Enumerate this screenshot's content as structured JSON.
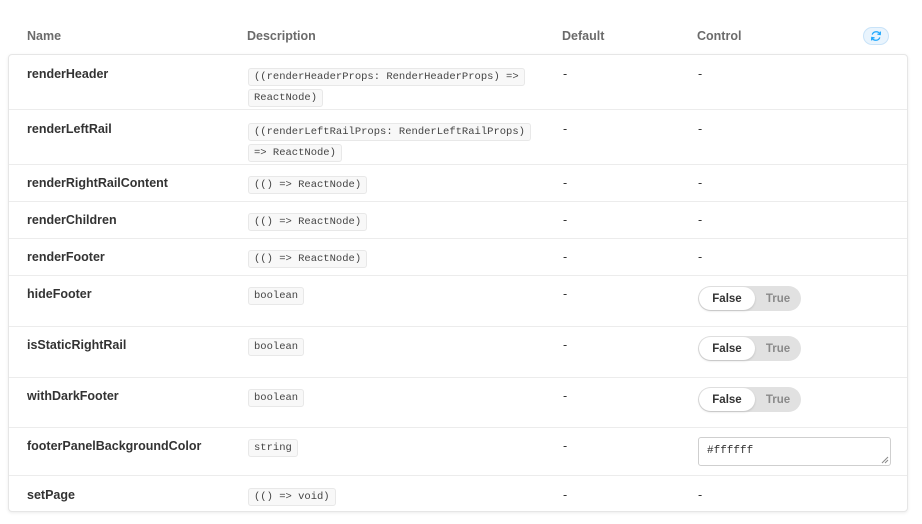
{
  "columns": {
    "name": "Name",
    "description": "Description",
    "default": "Default",
    "control": "Control"
  },
  "reset_icon": "refresh-icon",
  "colors": {
    "accent": "#1ea7fd",
    "border": "#e6e6e6",
    "toggle_bg": "#e1e1e1"
  },
  "rows": [
    {
      "name": "renderHeader",
      "type": "((renderHeaderProps: RenderHeaderProps) => ReactNode)",
      "default": "-",
      "control": "-"
    },
    {
      "name": "renderLeftRail",
      "type": "((renderLeftRailProps: RenderLeftRailProps) => ReactNode)",
      "default": "-",
      "control": "-"
    },
    {
      "name": "renderRightRailContent",
      "type": "(() => ReactNode)",
      "default": "-",
      "control": "-"
    },
    {
      "name": "renderChildren",
      "type": "(() => ReactNode)",
      "default": "-",
      "control": "-"
    },
    {
      "name": "renderFooter",
      "type": "(() => ReactNode)",
      "default": "-",
      "control": "-"
    },
    {
      "name": "hideFooter",
      "type": "boolean",
      "default": "-",
      "control_false": "False",
      "control_true": "True",
      "value": false
    },
    {
      "name": "isStaticRightRail",
      "type": "boolean",
      "default": "-",
      "control_false": "False",
      "control_true": "True",
      "value": false
    },
    {
      "name": "withDarkFooter",
      "type": "boolean",
      "default": "-",
      "control_false": "False",
      "control_true": "True",
      "value": false
    },
    {
      "name": "footerPanelBackgroundColor",
      "type": "string",
      "default": "-",
      "control_value": "#ffffff"
    },
    {
      "name": "setPage",
      "type": "(() => void)",
      "default": "-",
      "control": "-"
    }
  ]
}
